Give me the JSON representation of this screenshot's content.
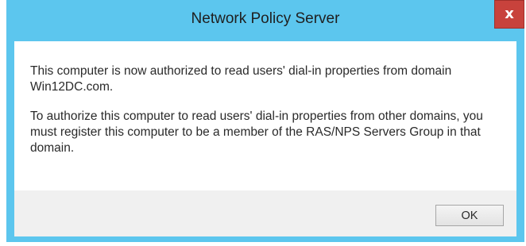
{
  "window": {
    "title": "Network Policy Server",
    "close_glyph": "x",
    "close_icon": "close-icon"
  },
  "message": {
    "paragraph_1": "This computer is now authorized to read users' dial-in properties from domain Win12DC.com.",
    "paragraph_2": "To authorize this computer to read users' dial-in properties from other domains, you must register this computer to be a member of the RAS/NPS Servers Group in that domain."
  },
  "buttons": {
    "ok_label": "OK"
  },
  "colors": {
    "title_bar": "#5cc6ee",
    "close_button": "#c8423c",
    "footer": "#f0f0f0"
  }
}
